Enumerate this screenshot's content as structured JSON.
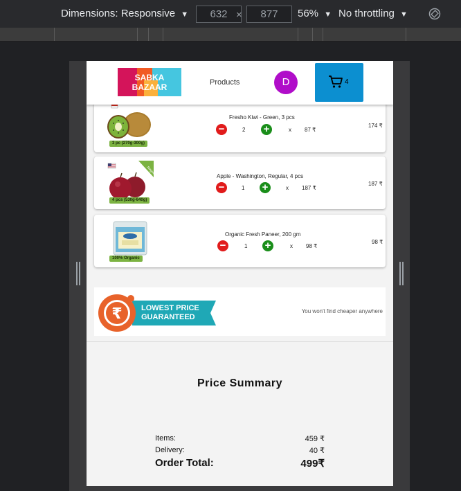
{
  "devtools": {
    "dimensions_label": "Dimensions: Responsive",
    "width_value": "632",
    "height_value": "877",
    "times": "×",
    "zoom": "56%",
    "throttling": "No throttling",
    "caret": "▼"
  },
  "header": {
    "logo_line1": "SABKA",
    "logo_line2": "BAZAAR",
    "nav_products": "Products",
    "avatar_initial": "D",
    "cart_count": "4"
  },
  "items": [
    {
      "name": "Fresho Kiwi - Green, 3 pcs",
      "badge": "3 pc (270g-300g)",
      "quantity": "2",
      "times": "x",
      "unit_price": "87 ₹",
      "total": "174 ₹"
    },
    {
      "name": "Apple - Washington, Regular, 4 pcs",
      "badge": "4 pcs (530g-640g)",
      "tag": "Regular",
      "quantity": "1",
      "times": "x",
      "unit_price": "187 ₹",
      "total": "187 ₹"
    },
    {
      "name": "Organic Fresh Paneer, 200 gm",
      "badge": "100% Organic",
      "quantity": "1",
      "times": "x",
      "unit_price": "98 ₹",
      "total": "98 ₹"
    }
  ],
  "banner": {
    "line1": "LOWEST PRICE",
    "line2": "GUARANTEED",
    "message": "You won't find cheaper anywhere"
  },
  "summary": {
    "title": "Price Summary",
    "items_label": "Items:",
    "items_value": "459 ₹",
    "delivery_label": "Delivery:",
    "delivery_value": "40 ₹",
    "total_label": "Order Total:",
    "total_value": "499₹"
  },
  "colors": {
    "cart_button": "#0c8fd0",
    "avatar": "#b00dc9",
    "minus": "#e11b1b",
    "plus": "#1a8e1a",
    "banner_teal": "#1fa8b6",
    "banner_orange": "#e8622a"
  }
}
